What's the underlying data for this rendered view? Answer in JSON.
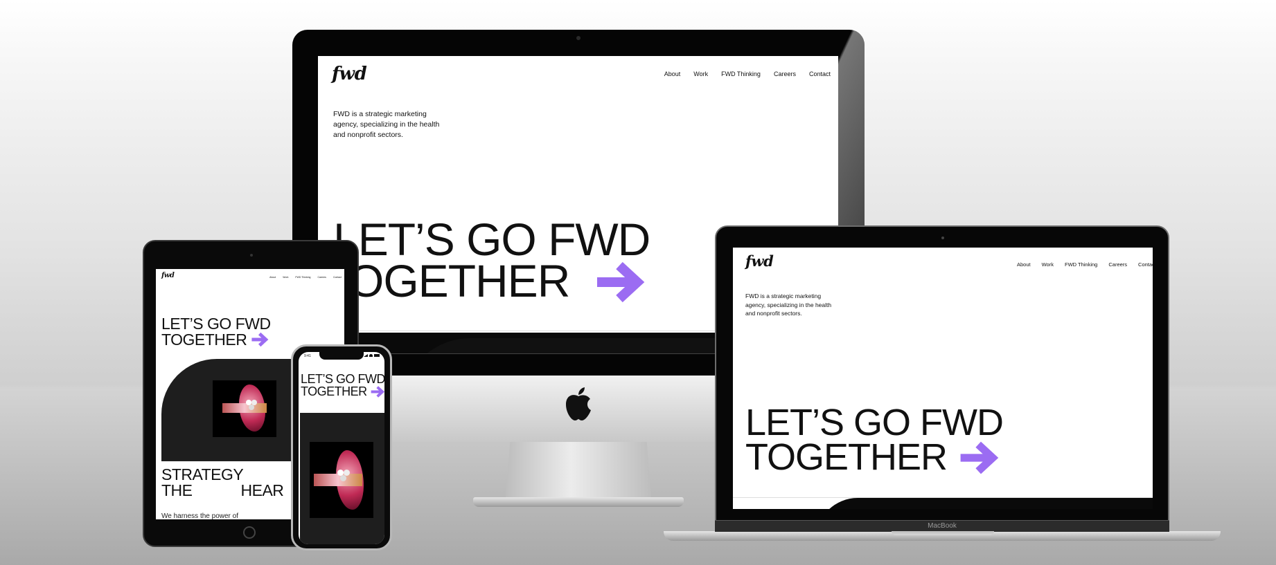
{
  "site": {
    "logo": "fwd",
    "nav": [
      "About",
      "Work",
      "FWD Thinking",
      "Careers",
      "Contact"
    ],
    "tagline_lines": [
      "FWD is a strategic marketing",
      "agency, specializing in the health",
      "and nonprofit sectors."
    ],
    "hero_line1": "LET’S GO FWD",
    "hero_line2": "TOGETHER",
    "accent_color": "#9b6cf2",
    "section2_line1": "STRATEGY",
    "section2_line2a": "THE",
    "section2_line2b": "HEAR",
    "section2_body": "We harness the power of"
  },
  "devices": {
    "laptop_brand": "MacBook",
    "phone_time": "9:41",
    "imac_logo_icon": "apple-logo-icon",
    "phone_status_icons": [
      "signal-icon",
      "wifi-icon",
      "battery-icon"
    ]
  },
  "imac_hero_visible": {
    "line1": "LET’S GO FWD",
    "line2": "OGETHER"
  }
}
